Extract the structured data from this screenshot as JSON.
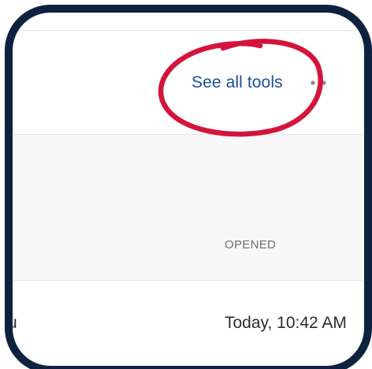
{
  "toolbar": {
    "see_all_tools_label": "See all tools",
    "more_icon": "more-horizontal-icon"
  },
  "table": {
    "columns": [
      "OPENED"
    ],
    "rows": [
      {
        "name_fragment": "u",
        "opened": "Today, 10:42 AM"
      }
    ]
  },
  "colors": {
    "frame": "#0e2240",
    "link": "#1a4c9c",
    "annotation_circle": "#d4143c",
    "band_background": "#f8f8f8"
  },
  "annotation": {
    "type": "hand-drawn-circle",
    "target": "see-all-tools-link"
  }
}
